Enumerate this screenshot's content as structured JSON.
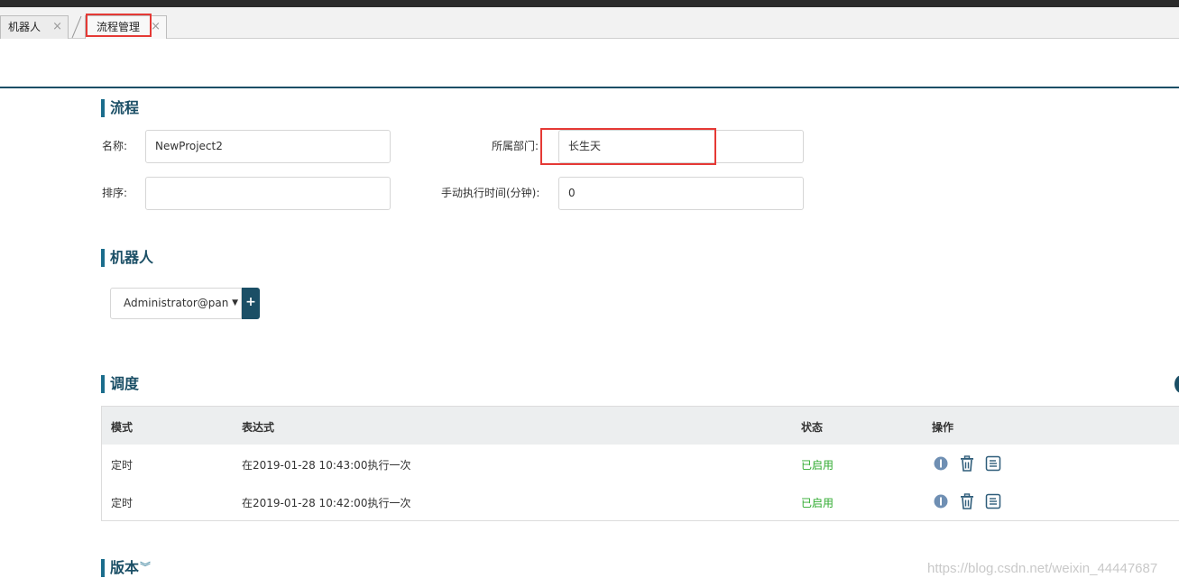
{
  "tabs": [
    {
      "label": "机器人",
      "close": "×"
    },
    {
      "label": "流程管理",
      "close": "×"
    }
  ],
  "process": {
    "title": "流程",
    "name_label": "名称:",
    "name_value": "NewProject2",
    "dept_label": "所属部门:",
    "dept_value": "长生天",
    "order_label": "排序:",
    "order_value": "",
    "manual_time_label": "手动执行时间(分钟):",
    "manual_time_value": "0"
  },
  "robot": {
    "title": "机器人",
    "selected": "Administrator@pan",
    "caret": "▼",
    "add_label": "+"
  },
  "schedule": {
    "title": "调度",
    "columns": [
      "模式",
      "表达式",
      "状态",
      "操作"
    ],
    "rows": [
      {
        "mode": "定时",
        "expression": "在2019-01-28 10:43:00执行一次",
        "status": "已启用"
      },
      {
        "mode": "定时",
        "expression": "在2019-01-28 10:42:00执行一次",
        "status": "已启用"
      }
    ],
    "row_icons": [
      "info-icon",
      "trash-icon",
      "document-icon"
    ]
  },
  "version": {
    "title": "版本",
    "caret": "︾"
  },
  "watermark": "https://blog.csdn.net/weixin_44447687",
  "colors": {
    "accent": "#1b4f66",
    "enabled": "#2eaa2e",
    "highlight": "#e53935",
    "icon": "#6f8fb3"
  }
}
